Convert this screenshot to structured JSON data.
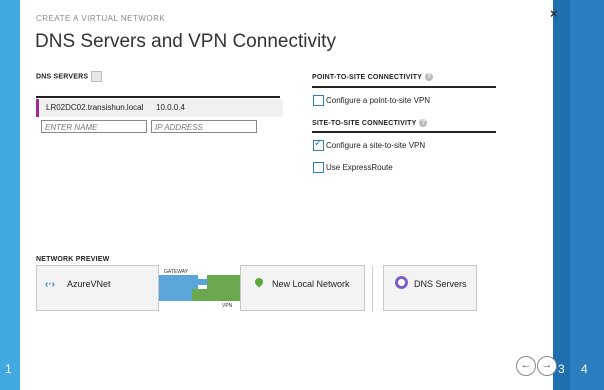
{
  "wizard": {
    "breadcrumb": "CREATE A VIRTUAL NETWORK",
    "title": "DNS Servers and VPN Connectivity",
    "close_symbol": "×",
    "steps": [
      "1",
      "3",
      "4"
    ]
  },
  "dns": {
    "section_label": "DNS SERVERS",
    "entries": [
      {
        "name": "LR02DC02.transishun.local",
        "ip": "10.0.0.4"
      }
    ],
    "name_placeholder": "ENTER NAME",
    "ip_placeholder": "IP ADDRESS"
  },
  "p2s": {
    "section_label": "POINT-TO-SITE CONNECTIVITY",
    "option_label": "Configure a point-to-site VPN",
    "checked": false
  },
  "s2s": {
    "section_label": "SITE-TO-SITE CONNECTIVITY",
    "option_label": "Configure a site-to-site VPN",
    "option_checked": true,
    "express_label": "Use ExpressRoute",
    "express_checked": false
  },
  "preview": {
    "section_label": "NETWORK PREVIEW",
    "vnet_label": "AzureVNet",
    "gateway_label": "GATEWAY",
    "vpn_label": "VPN",
    "local_label": "New Local Network",
    "dns_label": "DNS Servers",
    "colors": {
      "blue": "#5aa6da",
      "green": "#6aa84f",
      "vnet_icon": "#2b7fbe",
      "local_icon": "#5aa83f",
      "dns_icon": "#7b5fc9"
    }
  },
  "nav": {
    "back_symbol": "←",
    "next_symbol": "→"
  }
}
